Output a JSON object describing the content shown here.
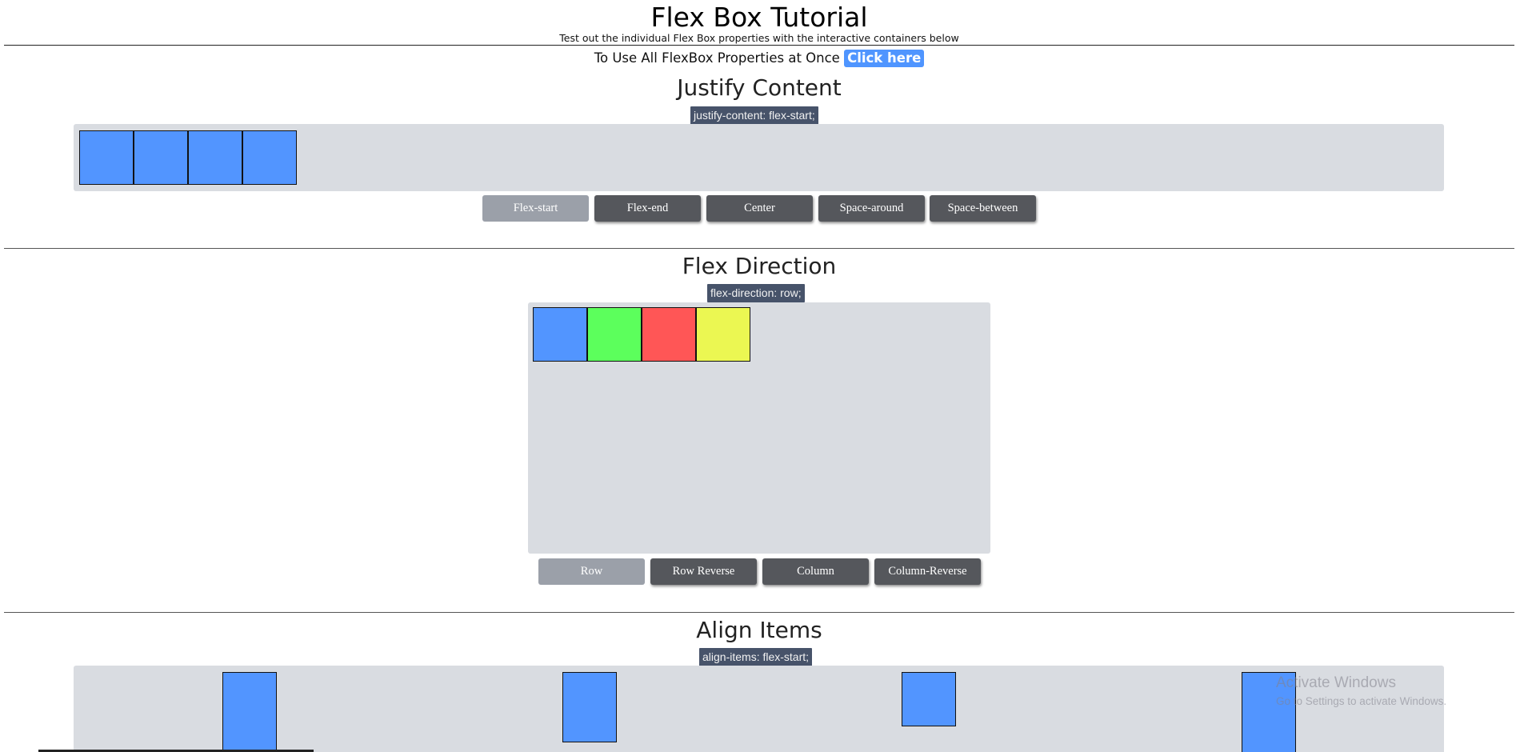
{
  "header": {
    "title": "Flex Box Tutorial",
    "subtitle": "Test out the individual Flex Box properties with the interactive containers below"
  },
  "all_properties": {
    "text": "To Use All FlexBox Properties at Once",
    "link_label": "Click here"
  },
  "justify_content": {
    "heading": "Justify Content",
    "code": "justify-content: flex-start;",
    "buttons": [
      "Flex-start",
      "Flex-end",
      "Center",
      "Space-around",
      "Space-between"
    ],
    "active_button": "Flex-start",
    "box_colors": [
      "#5295ff",
      "#5295ff",
      "#5295ff",
      "#5295ff"
    ]
  },
  "flex_direction": {
    "heading": "Flex Direction",
    "code": "flex-direction: row;",
    "buttons": [
      "Row",
      "Row Reverse",
      "Column",
      "Column-Reverse"
    ],
    "active_button": "Row",
    "box_colors": [
      "#5295ff",
      "#5cff5c",
      "#ff5656",
      "#ebf752"
    ]
  },
  "align_items": {
    "heading": "Align Items",
    "code": "align-items: flex-start;"
  },
  "watermark": {
    "line1": "Activate Windows",
    "line2": "Go to Settings to activate Windows."
  },
  "colors": {
    "accent": "#4f95ff",
    "button": "#55575c",
    "button_active": "#9ba0a9",
    "container": "#d9dce1",
    "badge": "#47536a"
  }
}
